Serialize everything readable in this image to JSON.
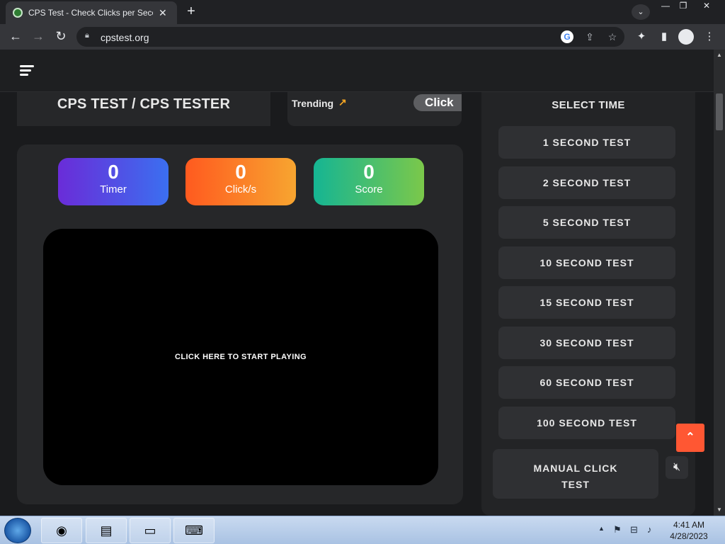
{
  "browser": {
    "tab_title": "CPS Test - Check Clicks per Second",
    "tab_close": "✕",
    "new_tab": "+",
    "url": "cpstest.org"
  },
  "site": {
    "title": "CPS TEST / CPS TESTER",
    "trending_label": "Trending",
    "trending_item": "Click",
    "stats": [
      {
        "value": "0",
        "label": "Timer"
      },
      {
        "value": "0",
        "label": "Click/s"
      },
      {
        "value": "0",
        "label": "Score"
      }
    ],
    "click_area_text": "CLICK HERE TO START PLAYING",
    "select_time_title": "SELECT TIME",
    "time_options": [
      "1 SECOND TEST",
      "2 SECOND TEST",
      "5 SECOND TEST",
      "10 SECOND TEST",
      "15 SECOND TEST",
      "30 SECOND TEST",
      "60 SECOND TEST",
      "100 SECOND TEST"
    ],
    "manual_click_test_line1": "MANUAL CLICK",
    "manual_click_test_line2": "TEST",
    "accent_colors": {
      "timer": "#3b6ff0",
      "cps": "#f7a530",
      "score": "#15b593",
      "scroll_top": "#ff5733"
    }
  },
  "taskbar": {
    "time": "4:41 AM",
    "date": "4/28/2023"
  }
}
